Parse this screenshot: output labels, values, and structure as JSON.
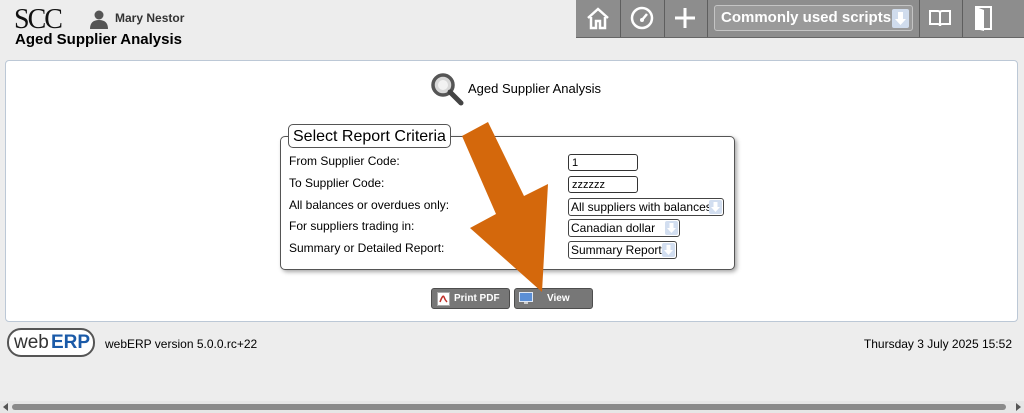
{
  "header": {
    "logo_text": "SCC",
    "user_name": "Mary Nestor",
    "page_heading": "Aged Supplier Analysis"
  },
  "toolbar": {
    "home_icon": "home-icon",
    "dashboard_icon": "dashboard-icon",
    "add_icon": "plus-icon",
    "scripts_label": "Commonly used scripts",
    "manual_icon": "book-icon",
    "logout_icon": "logout-icon"
  },
  "main": {
    "title": "Aged Supplier Analysis",
    "criteria_legend": "Select Report Criteria",
    "rows": {
      "from_code": {
        "label": "From Supplier Code:",
        "value": "1"
      },
      "to_code": {
        "label": "To Supplier Code:",
        "value": "zzzzzz"
      },
      "balances": {
        "label": "All balances or overdues only:",
        "value": "All suppliers with balances"
      },
      "currency": {
        "label": "For suppliers trading in:",
        "value": "Canadian dollar"
      },
      "report_type": {
        "label": "Summary or Detailed Report:",
        "value": "Summary Report"
      }
    },
    "buttons": {
      "print_pdf": "Print PDF",
      "view": "View"
    }
  },
  "footer": {
    "logo_web": "web",
    "logo_erp": "ERP",
    "version": "webERP version 5.0.0.rc+22",
    "datetime": "Thursday 3 July 2025 15:52"
  },
  "colors": {
    "accent_arrow": "#d4680c",
    "toolbar_bg": "#8d8d8d",
    "select_arrow": "#d2def0"
  }
}
